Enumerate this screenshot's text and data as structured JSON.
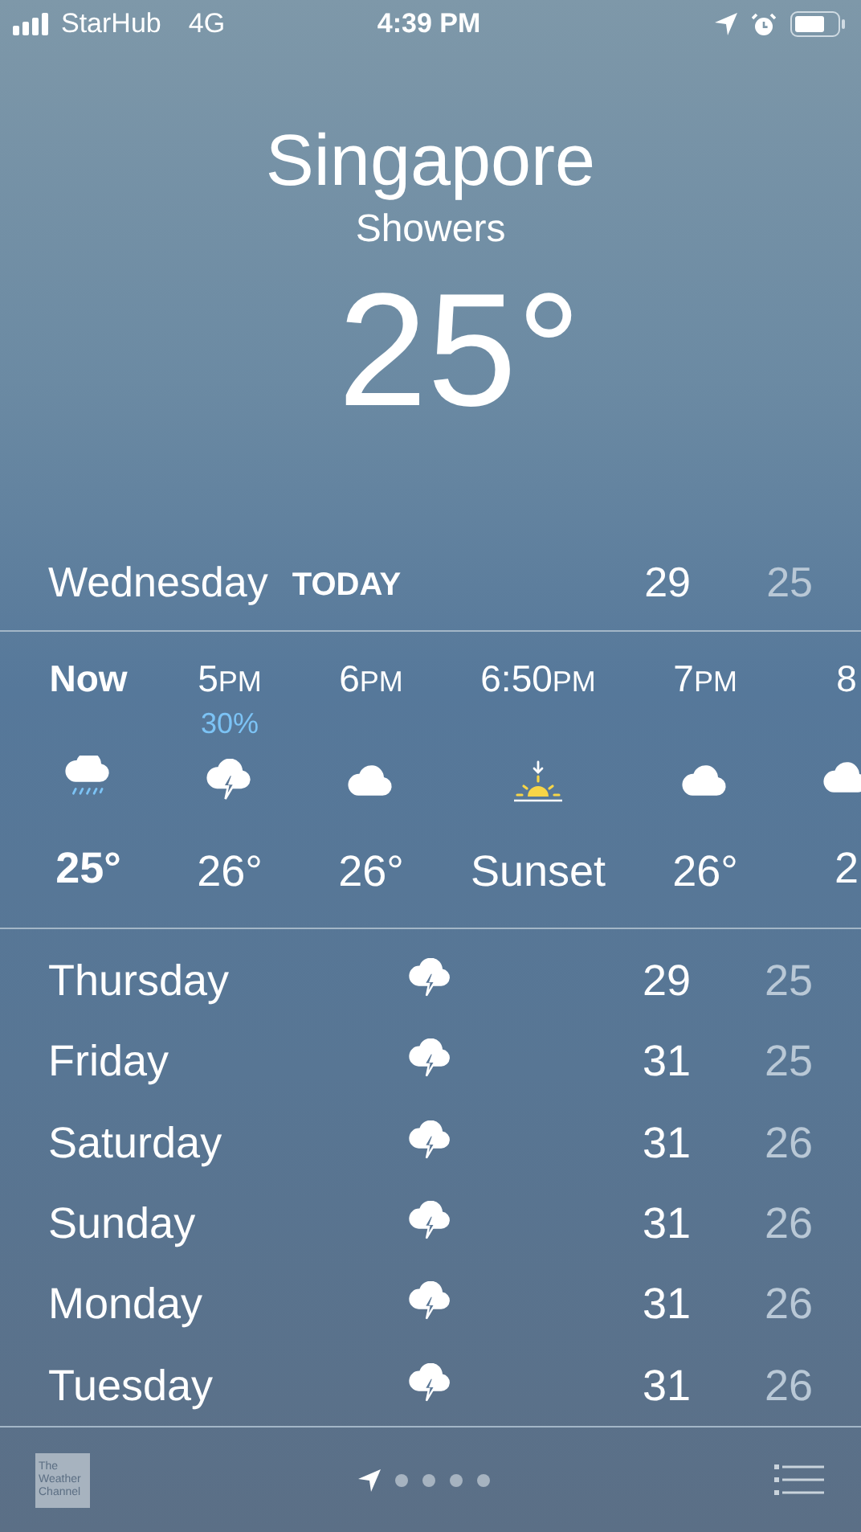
{
  "status_bar": {
    "carrier": "StarHub",
    "network": "4G",
    "time": "4:39 PM"
  },
  "location": {
    "city": "Singapore",
    "condition": "Showers",
    "temperature": "25°"
  },
  "today": {
    "day": "Wednesday",
    "label": "TODAY",
    "high": "29",
    "low": "25"
  },
  "hourly": [
    {
      "time": "Now",
      "current": true,
      "kind": "rain",
      "temp": "25°"
    },
    {
      "time": "5",
      "suffix": "PM",
      "precip": "30%",
      "current": false,
      "kind": "thunder",
      "temp": "26°"
    },
    {
      "time": "6",
      "suffix": "PM",
      "current": false,
      "kind": "cloud",
      "temp": "26°"
    },
    {
      "time": "6:50",
      "suffix": "PM",
      "current": false,
      "kind": "sunset",
      "temp": "Sunset"
    },
    {
      "time": "7",
      "suffix": "PM",
      "current": false,
      "kind": "cloud",
      "temp": "26°"
    },
    {
      "time": "8",
      "current": false,
      "kind": "cloud",
      "temp": "2"
    }
  ],
  "daily": [
    {
      "day": "Thursday",
      "kind": "thunder",
      "high": "29",
      "low": "25"
    },
    {
      "day": "Friday",
      "kind": "thunder",
      "high": "31",
      "low": "25"
    },
    {
      "day": "Saturday",
      "kind": "thunder",
      "high": "31",
      "low": "26"
    },
    {
      "day": "Sunday",
      "kind": "thunder",
      "high": "31",
      "low": "26"
    },
    {
      "day": "Monday",
      "kind": "thunder",
      "high": "31",
      "low": "26"
    },
    {
      "day": "Tuesday",
      "kind": "thunder",
      "high": "31",
      "low": "26"
    }
  ],
  "footer": {
    "logo_lines": [
      "The",
      "Weather",
      "Channel"
    ],
    "pages": [
      {
        "kind": "location"
      },
      {
        "kind": "dot"
      },
      {
        "kind": "dot"
      },
      {
        "kind": "dot"
      },
      {
        "kind": "dot"
      }
    ]
  }
}
